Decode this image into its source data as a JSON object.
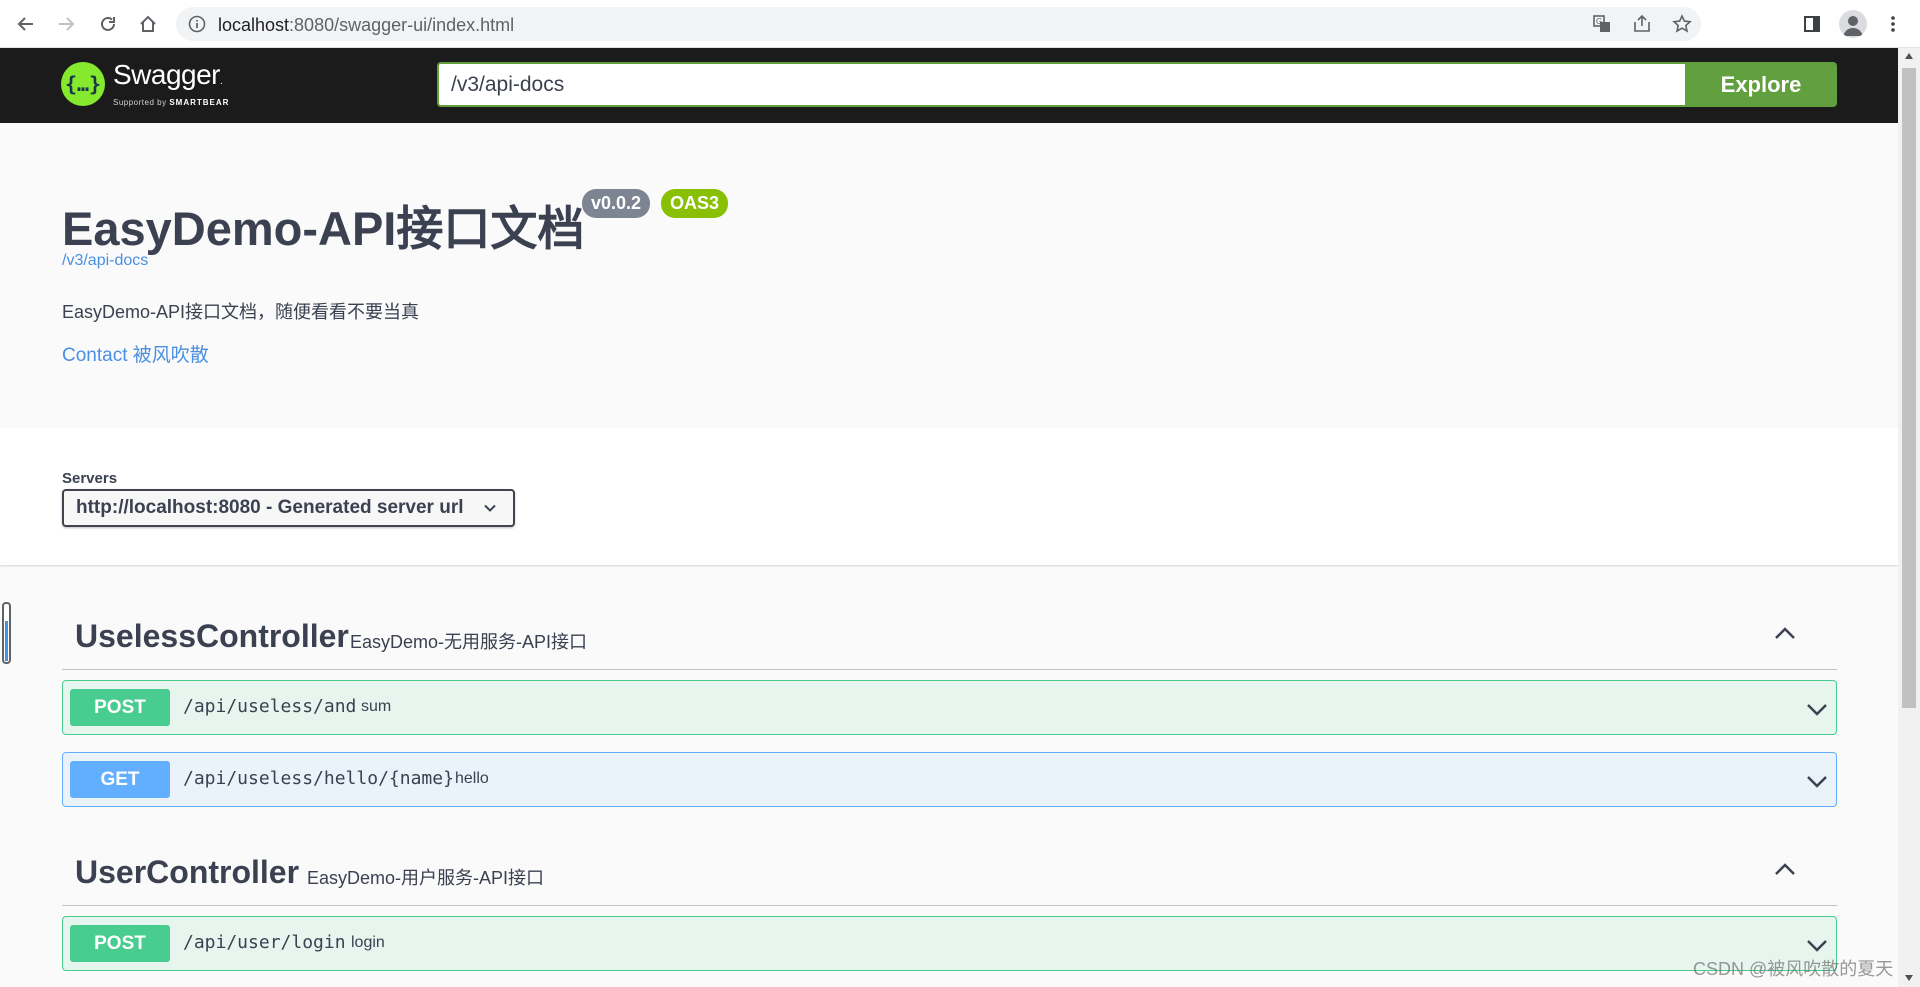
{
  "browser": {
    "url_host": "localhost",
    "url_path": ":8080/swagger-ui/index.html",
    "icons": [
      "back-icon",
      "forward-icon",
      "reload-icon",
      "home-icon",
      "info-icon",
      "translate-icon",
      "share-icon",
      "bookmark-star-icon",
      "side-panel-icon",
      "profile-avatar",
      "menu-dots-icon"
    ]
  },
  "topbar": {
    "logo_word": "Swagger",
    "logo_tm": ".",
    "logo_sub_prefix": "Supported by",
    "logo_sub_brand": "SMARTBEAR",
    "logo_glyph": "{…}",
    "url_input_value": "/v3/api-docs",
    "explore_label": "Explore"
  },
  "info": {
    "title": "EasyDemo-API接口文档",
    "version": "v0.0.2",
    "oas": "OAS3",
    "spec_link": "/v3/api-docs",
    "description": "EasyDemo-API接口文档，随便看看不要当真",
    "contact": "Contact 被风吹散"
  },
  "servers": {
    "label": "Servers",
    "selected": "http://localhost:8080 - Generated server url"
  },
  "tags": [
    {
      "name": "UselessController",
      "description": "EasyDemo-无用服务-API接口",
      "operations": [
        {
          "method": "POST",
          "path": "/api/useless/and",
          "summary": "sum"
        },
        {
          "method": "GET",
          "path": "/api/useless/hello/{name}",
          "summary": "hello"
        }
      ]
    },
    {
      "name": "UserController",
      "description": "EasyDemo-用户服务-API接口",
      "operations": [
        {
          "method": "POST",
          "path": "/api/user/login",
          "summary": "login"
        }
      ]
    }
  ],
  "watermark": "CSDN @被风吹散的夏天",
  "colors": {
    "topbar_bg": "#1b1b1b",
    "explore_green": "#62a03f",
    "post": "#49cc90",
    "get": "#61affe",
    "link": "#4990e2",
    "version_badge": "#7d8492",
    "oas_badge": "#89bf04"
  }
}
